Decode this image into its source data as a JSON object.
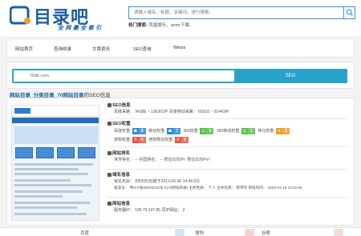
{
  "header": {
    "logo_text": "目录吧",
    "slogan": "全 网 最 全 索 引",
    "search_placeholder": "请输入域名、标题、关键词，进行搜索。",
    "hot_label": "热门搜索:",
    "hot_text": "凤凰娱乐、avmr下载、"
  },
  "nav": {
    "items": [
      "网站首页",
      "查询收录",
      "文章资讯",
      "SEO查询",
      "Whois"
    ]
  },
  "url_bar": {
    "value": "70dir.com",
    "button": "SEO"
  },
  "breadcrumb": {
    "site": "网站目录",
    "sep1": "_分类目录",
    "sep2": "_70网站目录",
    "suffix": "的SEO信息"
  },
  "seo_info": {
    "title": "SEO信息",
    "line": "百度来路：  94386 ~ 136301IP    百度移动来路：  60310 ~ 91443IP"
  },
  "weights": {
    "title": "SEO权重",
    "row1_label": "百度权重:",
    "row1": [
      {
        "label": "移动权重:",
        "value": "6",
        "color": "#2b8ad6"
      },
      {
        "label": "360权重:",
        "value": "7",
        "color": "#2b8ad6"
      },
      {
        "label": "360移动权重:",
        "value": "1",
        "color": "#5bbf4a"
      },
      {
        "label": "神马权重:",
        "value": "1",
        "color": "#5bbf4a"
      },
      {
        "label": "",
        "value": "1",
        "color": "#f0a020"
      }
    ],
    "row2_label": "搜狗权重:",
    "row2": [
      {
        "label": "搜狗移动权重:",
        "value": "0",
        "color": "#e8564a"
      },
      {
        "label": "",
        "value": "0",
        "color": "#e8564a"
      }
    ]
  },
  "ranking": {
    "title": "网站排名",
    "line": "世界排名：  -- 中国排名：  -- 预估日均IP≈  预估日均PV≈"
  },
  "domain_info": {
    "title": "域名信息",
    "line1": "域名年龄：  8年8天(创建于2013-09-06 14:46:53)",
    "line2": "备案号：  粤ICP备08035226号-5(70网站目录)  主体性质：  个人  主体名称：  蔡伟玲  审核时间：  2020-01-18 10:26:06"
  },
  "server_info": {
    "title": "网站信息",
    "line": "服务器IP：  106.75.247.85  同IP网站：  2"
  },
  "footer": {
    "items": [
      "百度",
      "搜狗",
      "谷歌"
    ]
  }
}
